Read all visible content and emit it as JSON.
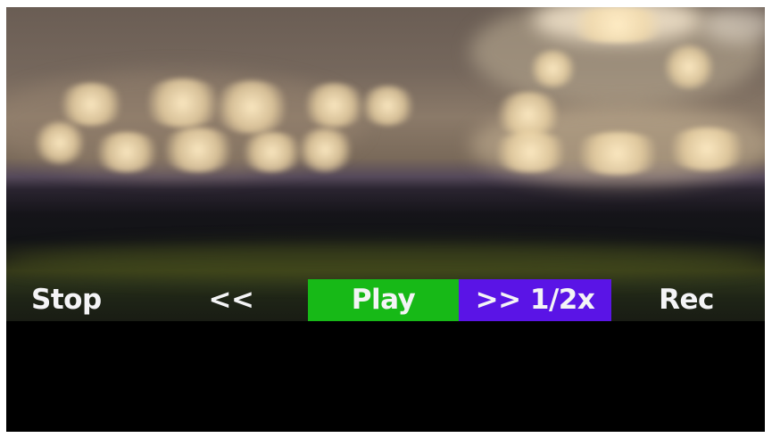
{
  "controls": {
    "stop_label": "Stop",
    "rewind_label": "<<",
    "play_label": "Play",
    "fast_forward_label": ">> 1/2x",
    "record_label": "Rec"
  },
  "colors": {
    "active_highlight": "#17b917",
    "speed_highlight": "#5a14e6",
    "label_text": "#f4f4f6",
    "lower_panel": "#000000"
  }
}
